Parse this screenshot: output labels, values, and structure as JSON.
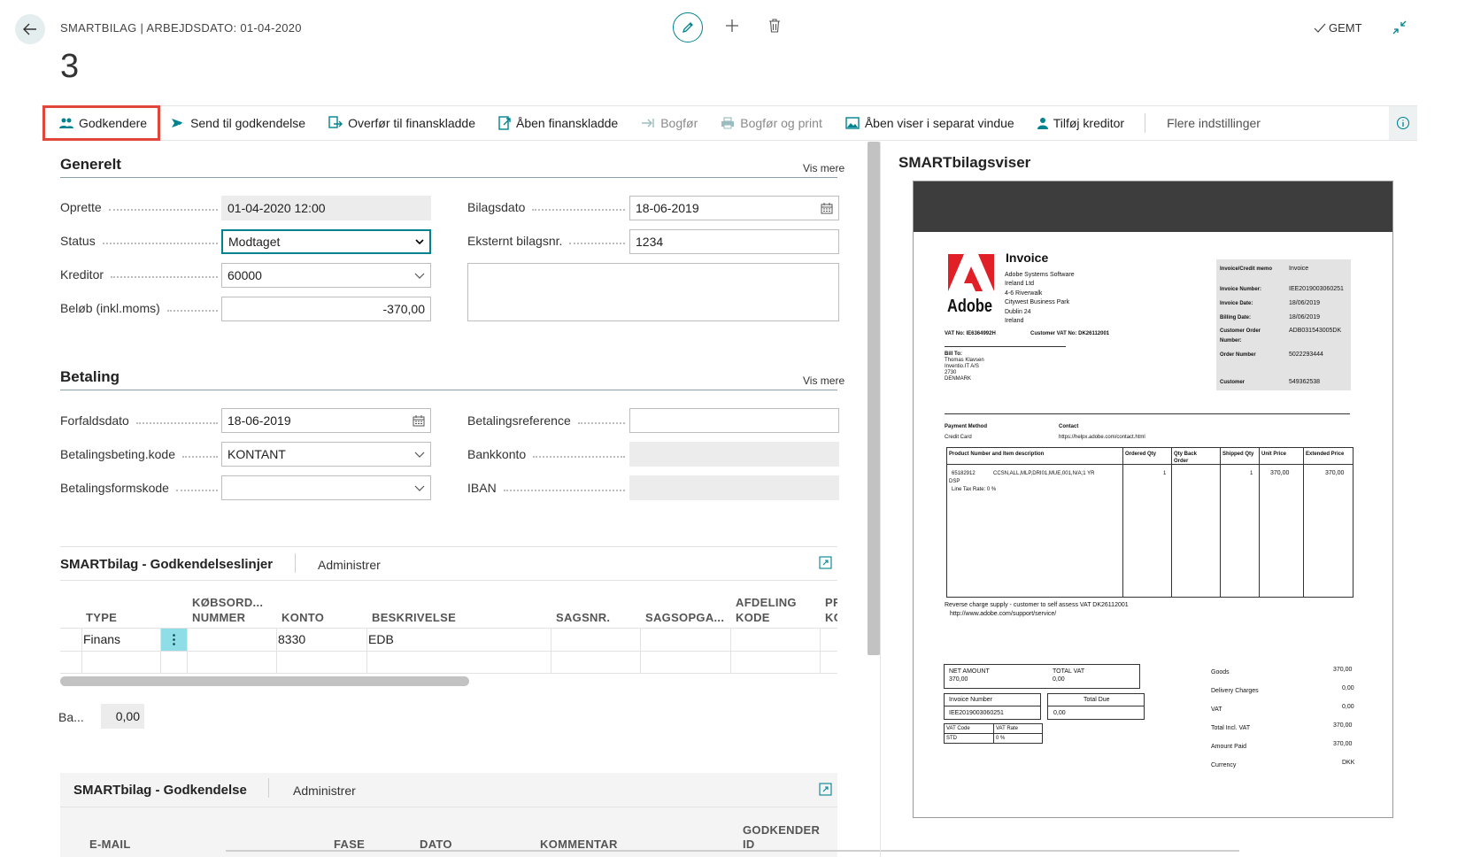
{
  "header": {
    "breadcrumb": "SMARTBILAG | ARBEJDSDATO: 01-04-2020",
    "record_number": "3",
    "saved_label": "GEMT"
  },
  "actions": [
    {
      "label": "Godkendere",
      "icon": "people-icon",
      "selected": true
    },
    {
      "label": "Send til godkendelse",
      "icon": "send-approval-icon"
    },
    {
      "label": "Overfør til finanskladde",
      "icon": "transfer-icon"
    },
    {
      "label": "Åben finanskladde",
      "icon": "open-journal-icon"
    },
    {
      "label": "Bogfør",
      "icon": "post-icon",
      "disabled": true
    },
    {
      "label": "Bogfør og print",
      "icon": "print-icon",
      "disabled": true
    },
    {
      "label": "Åben viser i separat vindue",
      "icon": "image-icon"
    },
    {
      "label": "Tilføj kreditor",
      "icon": "person-icon"
    }
  ],
  "more_options": "Flere indstillinger",
  "general": {
    "title": "Generelt",
    "show_more": "Vis mere",
    "created_label": "Oprette",
    "created_value": "01-04-2020 12:00",
    "status_label": "Status",
    "status_value": "Modtaget",
    "vendor_label": "Kreditor",
    "vendor_value": "60000",
    "amount_label": "Beløb (inkl.moms)",
    "amount_value": "-370,00",
    "doc_date_label": "Bilagsdato",
    "doc_date_value": "18-06-2019",
    "ext_doc_label": "Eksternt bilagsnr.",
    "ext_doc_value": "1234"
  },
  "payment": {
    "title": "Betaling",
    "show_more": "Vis mere",
    "due_label": "Forfaldsdato",
    "due_value": "18-06-2019",
    "terms_label": "Betalingsbeting.kode",
    "terms_value": "KONTANT",
    "method_label": "Betalingsformskode",
    "method_value": "",
    "ref_label": "Betalingsreference",
    "ref_value": "",
    "bank_label": "Bankkonto",
    "iban_label": "IBAN"
  },
  "lines": {
    "title": "SMARTbilag - Godkendelseslinjer",
    "manage": "Administrer",
    "columns": [
      "TYPE",
      "KØBSORD...",
      "NUMMER",
      "KONTO",
      "BESKRIVELSE",
      "SAGSNR.",
      "SAGSOPGA...",
      "AFDELING",
      "KODE",
      "PR",
      "KC"
    ],
    "row": {
      "type": "Finans",
      "konto": "8330",
      "beskrivelse": "EDB"
    },
    "balance_label": "Ba...",
    "balance_value": "0,00"
  },
  "approval": {
    "title": "SMARTbilag - Godkendelse",
    "manage": "Administrer",
    "columns": [
      "E-MAIL",
      "FASE",
      "DATO",
      "KOMMENTAR",
      "GODKENDER",
      "ID"
    ]
  },
  "viewer": {
    "title": "SMARTbilagsviser",
    "invoice": {
      "heading": "Invoice",
      "brand": "Adobe",
      "company": [
        "Adobe Systems Software",
        "Ireland Ltd",
        "4-6 Riverwalk",
        "Citywest Business Park",
        "Dublin 24",
        "Ireland"
      ],
      "vat_no": "VAT No:  IE6364992H",
      "cust_vat": "Customer VAT No:  DK26112001",
      "bill_to": [
        "Bill To:",
        "Thomas Klavsen",
        "Inventio.IT A/S",
        "2730",
        "DENMARK"
      ],
      "meta": [
        [
          "Invoice/Credit memo",
          "Invoice"
        ],
        [
          "Invoice Number:",
          "IEE2019003060251"
        ],
        [
          "Invoice Date:",
          "18/06/2019"
        ],
        [
          "Billing Date:",
          "18/06/2019"
        ],
        [
          "Customer Order",
          "ADB031543005DK"
        ],
        [
          "Number:",
          ""
        ],
        [
          "Order Number",
          "5022293444"
        ],
        [
          "Customer",
          "549362538"
        ]
      ],
      "payment_method_label": "Payment Method",
      "payment_method": "Credit Card",
      "contact_label": "Contact",
      "contact": "https://helpx.adobe.com/contact.html",
      "table_headers": [
        "Product Number and Item description",
        "Ordered Qty",
        "Qty Back",
        "Order",
        "Shipped Qty",
        "Unit Price",
        "Extended Price"
      ],
      "item_no": "65182912",
      "item_desc": "CCSN,ALL,MLP,DRI01,MUE,001,N/A;1 YR",
      "item_desc2": "DSP",
      "ordered": "1",
      "shipped": "1",
      "unit_price": "370,00",
      "ext_price": "370,00",
      "tax_rate": "Line Tax Rate: 0   %",
      "reverse": "Reverse charge supply - customer to self assess VAT  DK26112001",
      "support": "http://www.adobe.com/support/service/",
      "net_label": "NET AMOUNT",
      "net_value": "370,00",
      "vat_label": "TOTAL VAT",
      "vat_value": "0,00",
      "invno_label": "Invoice Number",
      "invno_value": "IEE2019003060251",
      "due_label": "Total Due",
      "due_value": "0,00",
      "vat_code": "VAT Code",
      "vat_rate": "VAT Rate",
      "std": "STD",
      "pct": "0 %",
      "summary": [
        [
          "Goods",
          "370,00"
        ],
        [
          "Delivery Charges",
          "0,00"
        ],
        [
          "VAT",
          "0,00"
        ],
        [
          "Total Incl. VAT",
          "370,00"
        ],
        [
          "Amount Paid",
          "370,00"
        ],
        [
          "Currency",
          "DKK"
        ]
      ]
    }
  },
  "colors": {
    "accent": "#00838f",
    "highlight": "#e0463a",
    "cell_highlight": "#8fdde6"
  }
}
